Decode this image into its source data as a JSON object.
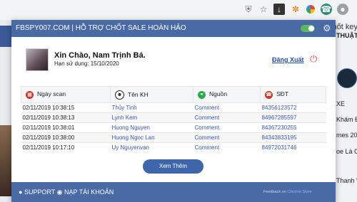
{
  "browser": {
    "toolbar_icons": [
      "shield-icon",
      "star-icon",
      "download-icon",
      "extension-icon",
      "extension-icon-2",
      "fbspy-extension-icon",
      "profile-avatar"
    ],
    "overflow_text": "chốt key s"
  },
  "background_page": {
    "right_texts": [
      "THUẬT GÁ",
      "XE",
      "Khám Đa",
      "mes 2021",
      "oe Là Cuộ",
      "Thanh Vă"
    ]
  },
  "popup": {
    "title": "FBSPY007.COM | HỖ TRỢ CHỐT SALE HOÀN HẢO",
    "toggle_on": true,
    "greeting": "Xin Chào, Nam Trịnh Bá.",
    "expiry": "Hạn sử dụng: 15/10/2020",
    "logout": "Đăng Xuất",
    "table": {
      "headers": [
        "Ngày scan",
        "Tên KH",
        "Nguồn",
        "SĐT"
      ],
      "header_icons": [
        "calendar-icon",
        "user-icon",
        "source-icon",
        "phone-icon"
      ],
      "rows": [
        {
          "date": "02/11/2019 10:38:15",
          "name": "Thủy Tinh",
          "source": "Comment",
          "phone": "84356123572"
        },
        {
          "date": "02/11/2019 10:38:13",
          "name": "Lynh Kem",
          "source": "Comment",
          "phone": "84967285597"
        },
        {
          "date": "02/11/2019 10:38:01",
          "name": "Huong Nguyen",
          "source": "Comment",
          "phone": "84367230255"
        },
        {
          "date": "02/11/2019 10:38:00",
          "name": "Huong Ngoc Lan",
          "source": "Comment",
          "phone": "84343833195"
        },
        {
          "date": "02/11/2019 10:17:10",
          "name": "Uy Nguyenvan",
          "source": "Comment",
          "phone": "84972031746"
        }
      ]
    },
    "more_button": "Xem Thêm",
    "footer": {
      "support": "SUPPORT",
      "topup": "NẠP TÀI KHOẢN",
      "feedback_label": "Feedback on",
      "feedback_link": "Chrome Store"
    }
  },
  "colors": {
    "header_blue": "#4a6aa5",
    "button_blue": "#3f66a9",
    "link_blue": "#3b5bab",
    "logout_red": "#d9534f",
    "toggle_green": "#5cb85c"
  }
}
